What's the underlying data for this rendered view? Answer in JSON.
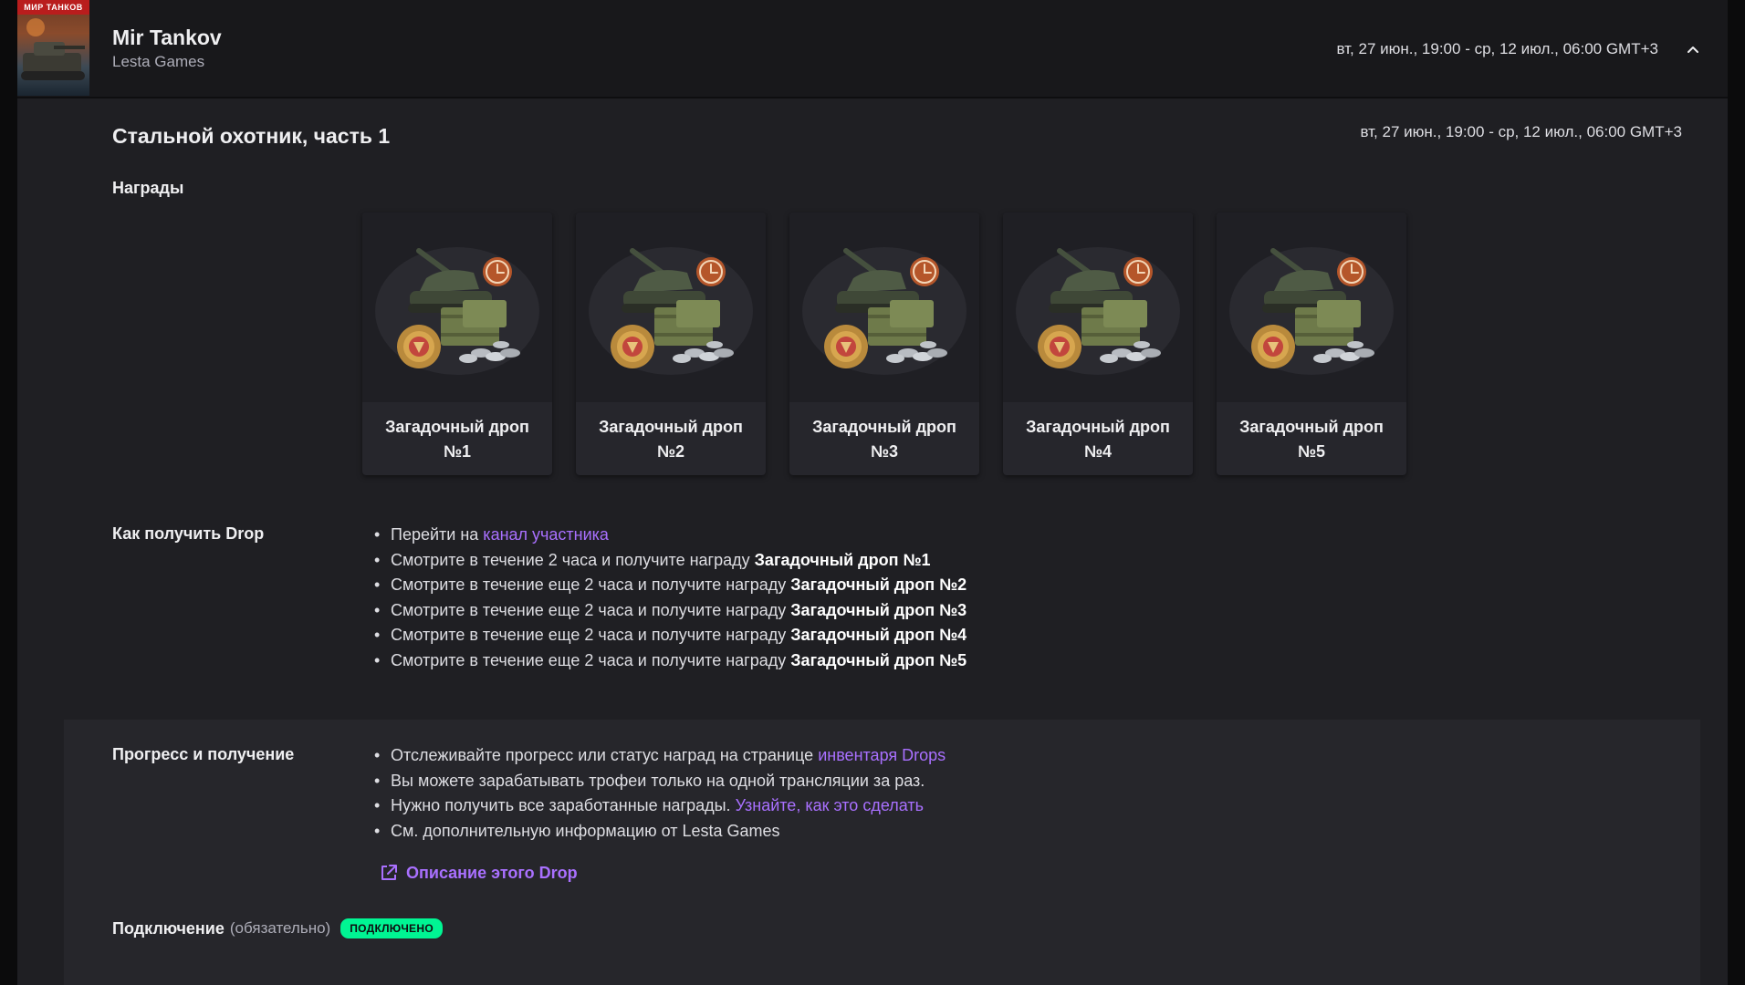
{
  "header": {
    "game_title": "Mir Tankov",
    "publisher": "Lesta Games",
    "cover_text": "МИР ТАНКОВ",
    "dates": "вт, 27 июн., 19:00 - ср, 12 июл., 06:00 GMT+3",
    "collapse_icon": "chevron-up-icon"
  },
  "campaign": {
    "title": "Стальной охотник, часть 1",
    "dates": "вт, 27 июн., 19:00 - ср, 12 июл., 06:00 GMT+3"
  },
  "rewards": {
    "label": "Награды",
    "items": [
      {
        "line1": "Загадочный дроп",
        "line2": "№1"
      },
      {
        "line1": "Загадочный дроп",
        "line2": "№2"
      },
      {
        "line1": "Загадочный дроп",
        "line2": "№3"
      },
      {
        "line1": "Загадочный дроп",
        "line2": "№4"
      },
      {
        "line1": "Загадочный дроп",
        "line2": "№5"
      }
    ]
  },
  "how_to": {
    "label": "Как получить Drop",
    "go_to": "Перейти на",
    "channel_link": "канал участника",
    "first_prefix": "Смотрите в течение 2 часа и получите награду",
    "next_prefix": "Смотрите в течение еще 2 часа и получите награду",
    "reward_names": [
      "Загадочный дроп №1",
      "Загадочный дроп №2",
      "Загадочный дроп №3",
      "Загадочный дроп №4",
      "Загадочный дроп №5"
    ]
  },
  "progress": {
    "label": "Прогресс и получение",
    "track_text": "Отслеживайте прогресс или статус наград на странице",
    "inventory_link": "инвентаря Drops",
    "one_stream": "Вы можете зарабатывать трофеи только на одной трансляции за раз.",
    "claim_text": "Нужно получить все заработанные награды.",
    "learn_link": "Узнайте, как это сделать",
    "more_info": "См. дополнительную информацию от Lesta Games",
    "description_link": "Описание этого Drop"
  },
  "connection": {
    "label": "Подключение",
    "hint": "(обязательно)",
    "status": "ПОДКЛЮЧЕНО"
  },
  "colors": {
    "accent": "#a970ff",
    "connected": "#00f593",
    "background": "#1f1f23"
  }
}
